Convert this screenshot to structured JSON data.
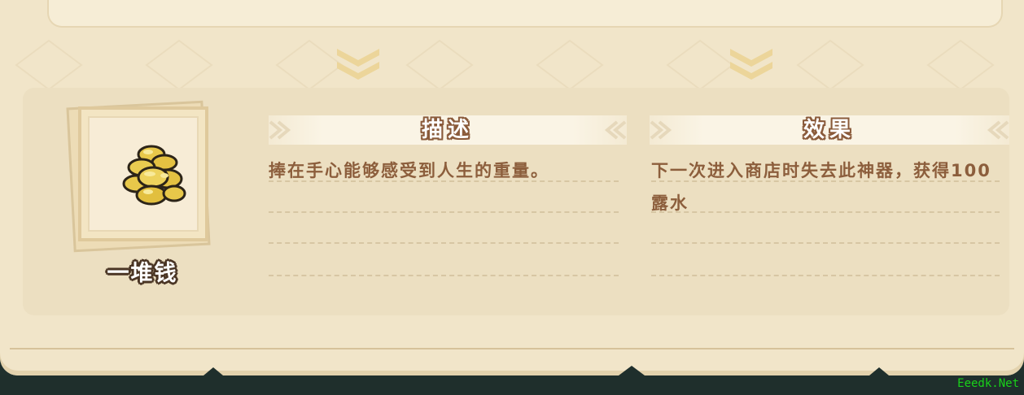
{
  "item": {
    "name": "一堆钱",
    "icon": "coin-pile-icon"
  },
  "sections": {
    "description": {
      "title": "描述",
      "text": "捧在手心能够感受到人生的重量。"
    },
    "effect": {
      "title": "效果",
      "text": "下一次进入商店时失去此神器，获得100露水"
    }
  },
  "watermark": "Eeedk.Net",
  "colors": {
    "parchment": "#f1e5c9",
    "inner_panel": "#ecdfc1",
    "text_brown": "#8c5e3c",
    "title_outline": "#8a5a3a",
    "chevron_gold": "#ecd59a",
    "coin_gold": "#e8c84a",
    "bottom_strip": "#1f2f2c",
    "watermark_green": "#19d219"
  }
}
